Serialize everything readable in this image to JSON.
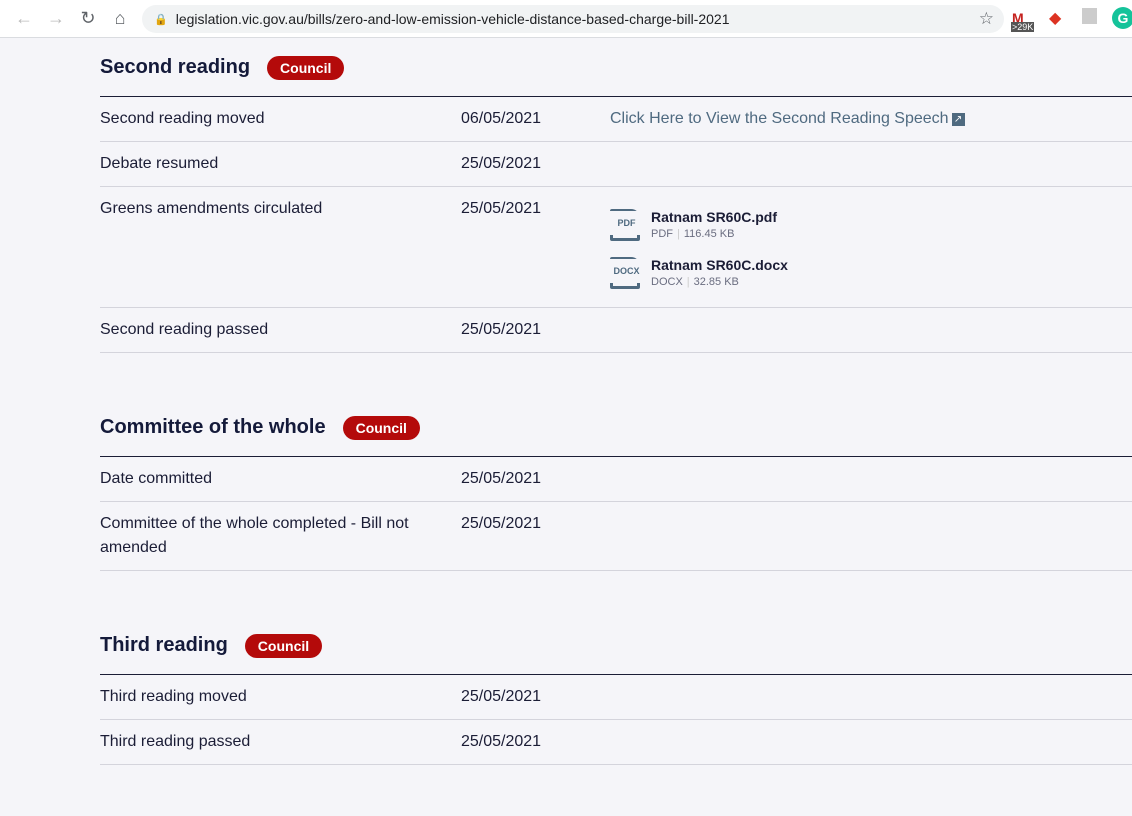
{
  "browser": {
    "url": "legislation.vic.gov.au/bills/zero-and-low-emission-vehicle-distance-based-charge-bill-2021",
    "gmail_badge": ">29K"
  },
  "sections": [
    {
      "title": "Second reading",
      "badge": "Council",
      "rows": [
        {
          "label": "Second reading moved",
          "date": "06/05/2021",
          "link": "Click Here to View the Second Reading Speech"
        },
        {
          "label": "Debate resumed",
          "date": "25/05/2021"
        },
        {
          "label": "Greens amendments circulated",
          "date": "25/05/2021",
          "files": [
            {
              "name": "Ratnam SR60C.pdf",
              "type": "PDF",
              "size": "116.45 KB"
            },
            {
              "name": "Ratnam SR60C.docx",
              "type": "DOCX",
              "size": "32.85 KB"
            }
          ]
        },
        {
          "label": "Second reading passed",
          "date": "25/05/2021"
        }
      ]
    },
    {
      "title": "Committee of the whole",
      "badge": "Council",
      "rows": [
        {
          "label": "Date committed",
          "date": "25/05/2021"
        },
        {
          "label": "Committee of the whole completed - Bill not amended",
          "date": "25/05/2021"
        }
      ]
    },
    {
      "title": "Third reading",
      "badge": "Council",
      "rows": [
        {
          "label": "Third reading moved",
          "date": "25/05/2021"
        },
        {
          "label": "Third reading passed",
          "date": "25/05/2021"
        }
      ]
    }
  ]
}
